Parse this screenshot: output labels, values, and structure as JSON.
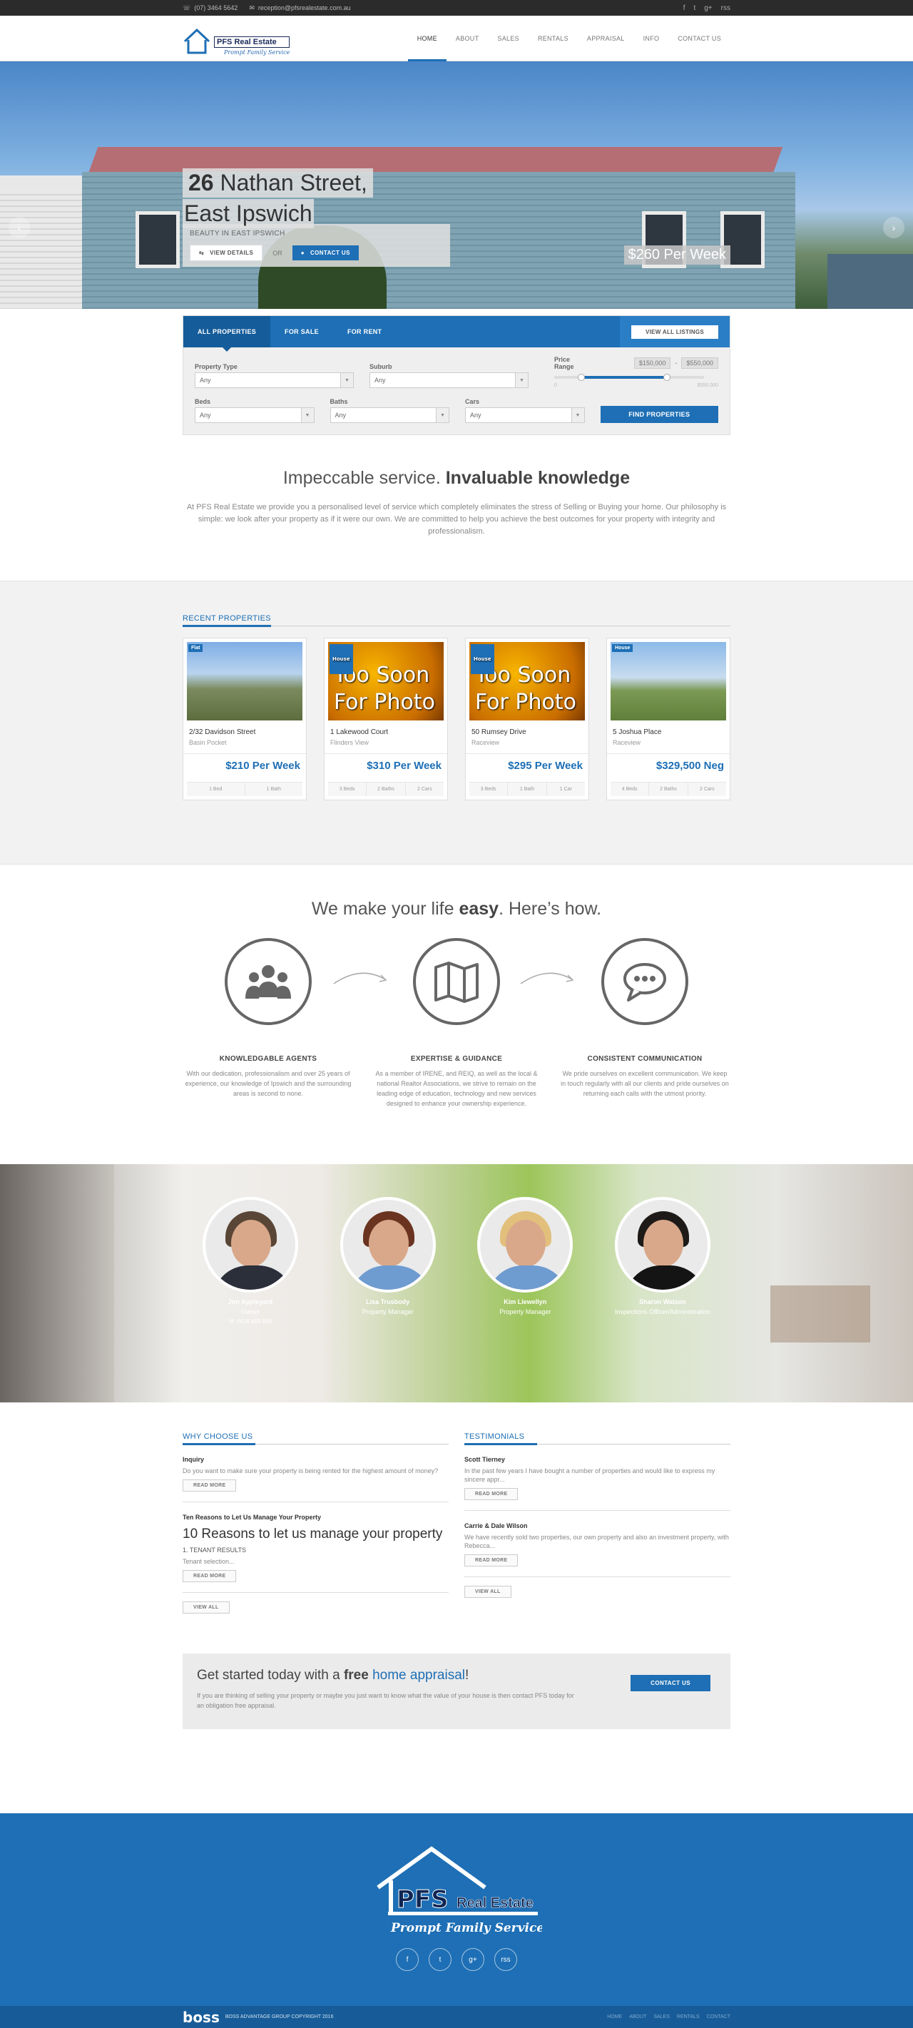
{
  "topbar": {
    "phone": "(07) 3464 5642",
    "email": "reception@pfsrealestate.com.au",
    "social": [
      "f",
      "t",
      "g+",
      "rss"
    ]
  },
  "logo": {
    "name": "PFS Real Estate",
    "tagline": "Prompt Family Service"
  },
  "nav": [
    {
      "label": "HOME",
      "active": true
    },
    {
      "label": "ABOUT"
    },
    {
      "label": "SALES"
    },
    {
      "label": "RENTALS"
    },
    {
      "label": "APPRAISAL"
    },
    {
      "label": "INFO"
    },
    {
      "label": "CONTACT US"
    }
  ],
  "hero": {
    "number": "26",
    "street": "Nathan Street,",
    "suburb": "East Ipswich",
    "subtitle": "BEAUTY IN EAST IPSWICH",
    "view_details": "VIEW DETAILS",
    "or": "OR",
    "contact": "CONTACT US",
    "price": "$260 Per Week",
    "prev": "‹",
    "next": "›"
  },
  "search": {
    "tabs": [
      "ALL PROPERTIES",
      "FOR SALE",
      "FOR RENT"
    ],
    "view_all": "VIEW ALL LISTINGS",
    "property_type": {
      "label": "Property Type",
      "value": "Any"
    },
    "suburb": {
      "label": "Suburb",
      "value": "Any"
    },
    "price_range": {
      "label": "Price Range",
      "min": "$150,000",
      "max": "$550,000",
      "sep": "-",
      "low": "0",
      "high": "$550,000",
      "from_frac": 0.18,
      "to_frac": 0.75
    },
    "beds": {
      "label": "Beds",
      "value": "Any"
    },
    "baths": {
      "label": "Baths",
      "value": "Any"
    },
    "cars": {
      "label": "Cars",
      "value": "Any"
    },
    "find": "FIND PROPERTIES"
  },
  "intro": {
    "title_normal": "Impeccable service.",
    "title_bold": "Invaluable knowledge",
    "text": "At PFS Real Estate we provide you a personalised level of service which completely eliminates the stress of Selling or Buying your home. Our philosophy is simple: we look after your property as if it were our own. We are committed to help you achieve the best outcomes for your property with integrity and professionalism."
  },
  "recent": {
    "heading": "RECENT PROPERTIES",
    "cards": [
      {
        "tag": "Flat",
        "address": "2/32 Davidson Street",
        "suburb": "Basin Pocket",
        "price": "$210 Per Week",
        "features": [
          "1 Bed",
          "1 Bath"
        ],
        "photo": "photo1",
        "img_text": ""
      },
      {
        "tag": "House",
        "address": "1 Lakewood Court",
        "suburb": "Flinders View",
        "price": "$310 Per Week",
        "features": [
          "3 Beds",
          "2 Baths",
          "2 Cars"
        ],
        "photo": "tsp",
        "img_text": "Too Soon For Photo"
      },
      {
        "tag": "House",
        "address": "50 Rumsey Drive",
        "suburb": "Raceview",
        "price": "$295 Per Week",
        "features": [
          "3 Beds",
          "1 Bath",
          "1 Car"
        ],
        "photo": "tsp",
        "img_text": "Too Soon For Photo"
      },
      {
        "tag": "House",
        "address": "5 Joshua Place",
        "suburb": "Raceview",
        "price": "$329,500 Neg",
        "features": [
          "4 Beds",
          "2 Baths",
          "2 Cars"
        ],
        "photo": "photo2",
        "img_text": ""
      }
    ]
  },
  "how": {
    "title_a": "We make your life",
    "title_b": "easy",
    "title_c": ". Here’s how.",
    "steps": [
      {
        "title": "KNOWLEDGABLE AGENTS",
        "text": "With our dedication, professionalism and over 25 years of experience, our knowledge of Ipswich and the surrounding areas is second to none.",
        "icon": "group-icon"
      },
      {
        "title": "EXPERTISE & GUIDANCE",
        "text": "As a member of IRENE, and REIQ, as well as the local & national Realtor Associations, we strive to remain on the leading edge of education, technology and new services designed to enhance your ownership experience.",
        "icon": "map-icon"
      },
      {
        "title": "CONSISTENT COMMUNICATION",
        "text": "We pride ourselves on excellent communication. We keep in touch regularly with all our clients and pride ourselves on returning each calls with the utmost priority.",
        "icon": "chat-bubble-icon"
      }
    ]
  },
  "team": [
    {
      "name": "Jon Appleyard",
      "role": "Owner",
      "phone": "M: 0418 888 808",
      "hair": "#5a4636",
      "body": "#2a2f3a"
    },
    {
      "name": "Lisa Trusbody",
      "role": "Property Manager",
      "phone": "",
      "hair": "#6a3420",
      "body": "#6e9bd0"
    },
    {
      "name": "Kim Llewellyn",
      "role": "Property Manager",
      "phone": "",
      "hair": "#e2c07c",
      "body": "#6e9bd0"
    },
    {
      "name": "Sharon Watson",
      "role": "Inspections Officer/Administration",
      "phone": "",
      "hair": "#1e1a18",
      "body": "#141414"
    }
  ],
  "why": {
    "heading": "WHY CHOOSE US",
    "items": [
      {
        "title": "Inquiry",
        "text": "Do you want to make sure your property is being rented for the highest amount of money?",
        "btn": "READ MORE"
      },
      {
        "title": "Ten Reasons to Let Us Manage Your Property",
        "big": "10 Reasons to let us manage your property",
        "sm": "1. TENANT RESULTS",
        "text": "Tenant selection...",
        "btn": "READ MORE"
      }
    ],
    "view_all": "VIEW ALL"
  },
  "testimonials": {
    "heading": "TESTIMONIALS",
    "items": [
      {
        "title": "Scott Tierney",
        "text": "In the past few years I have bought a number of properties and would like to express my sincere appr...",
        "btn": "READ MORE"
      },
      {
        "title": "Carrie & Dale Wilson",
        "text": "We have recently sold two properties, our own property and also an investment property, with Rebecca...",
        "btn": "READ MORE"
      }
    ],
    "view_all": "VIEW ALL"
  },
  "cta": {
    "title_a": "Get started today with a",
    "title_b": "free",
    "title_c": "home appraisal",
    "title_d": "!",
    "text": "If you are thinking of selling your property or maybe you just want to know what the value of your house is then contact PFS today for an obligation free appraisal.",
    "btn": "CONTACT US"
  },
  "footer": {
    "logo_main": "PFS",
    "logo_sub": "Real Estate",
    "tagline": "Prompt Family Service",
    "social": [
      "f",
      "t",
      "g+",
      "rss"
    ],
    "brand": "boss",
    "copyright": "BOSS ADVANTAGE GROUP COPYRIGHT 2016",
    "links": [
      "HOME",
      "ABOUT",
      "SALES",
      "RENTALS",
      "CONTACT"
    ]
  },
  "colors": {
    "brand": "#1e6fb5",
    "dark": "#2b2b2b"
  }
}
